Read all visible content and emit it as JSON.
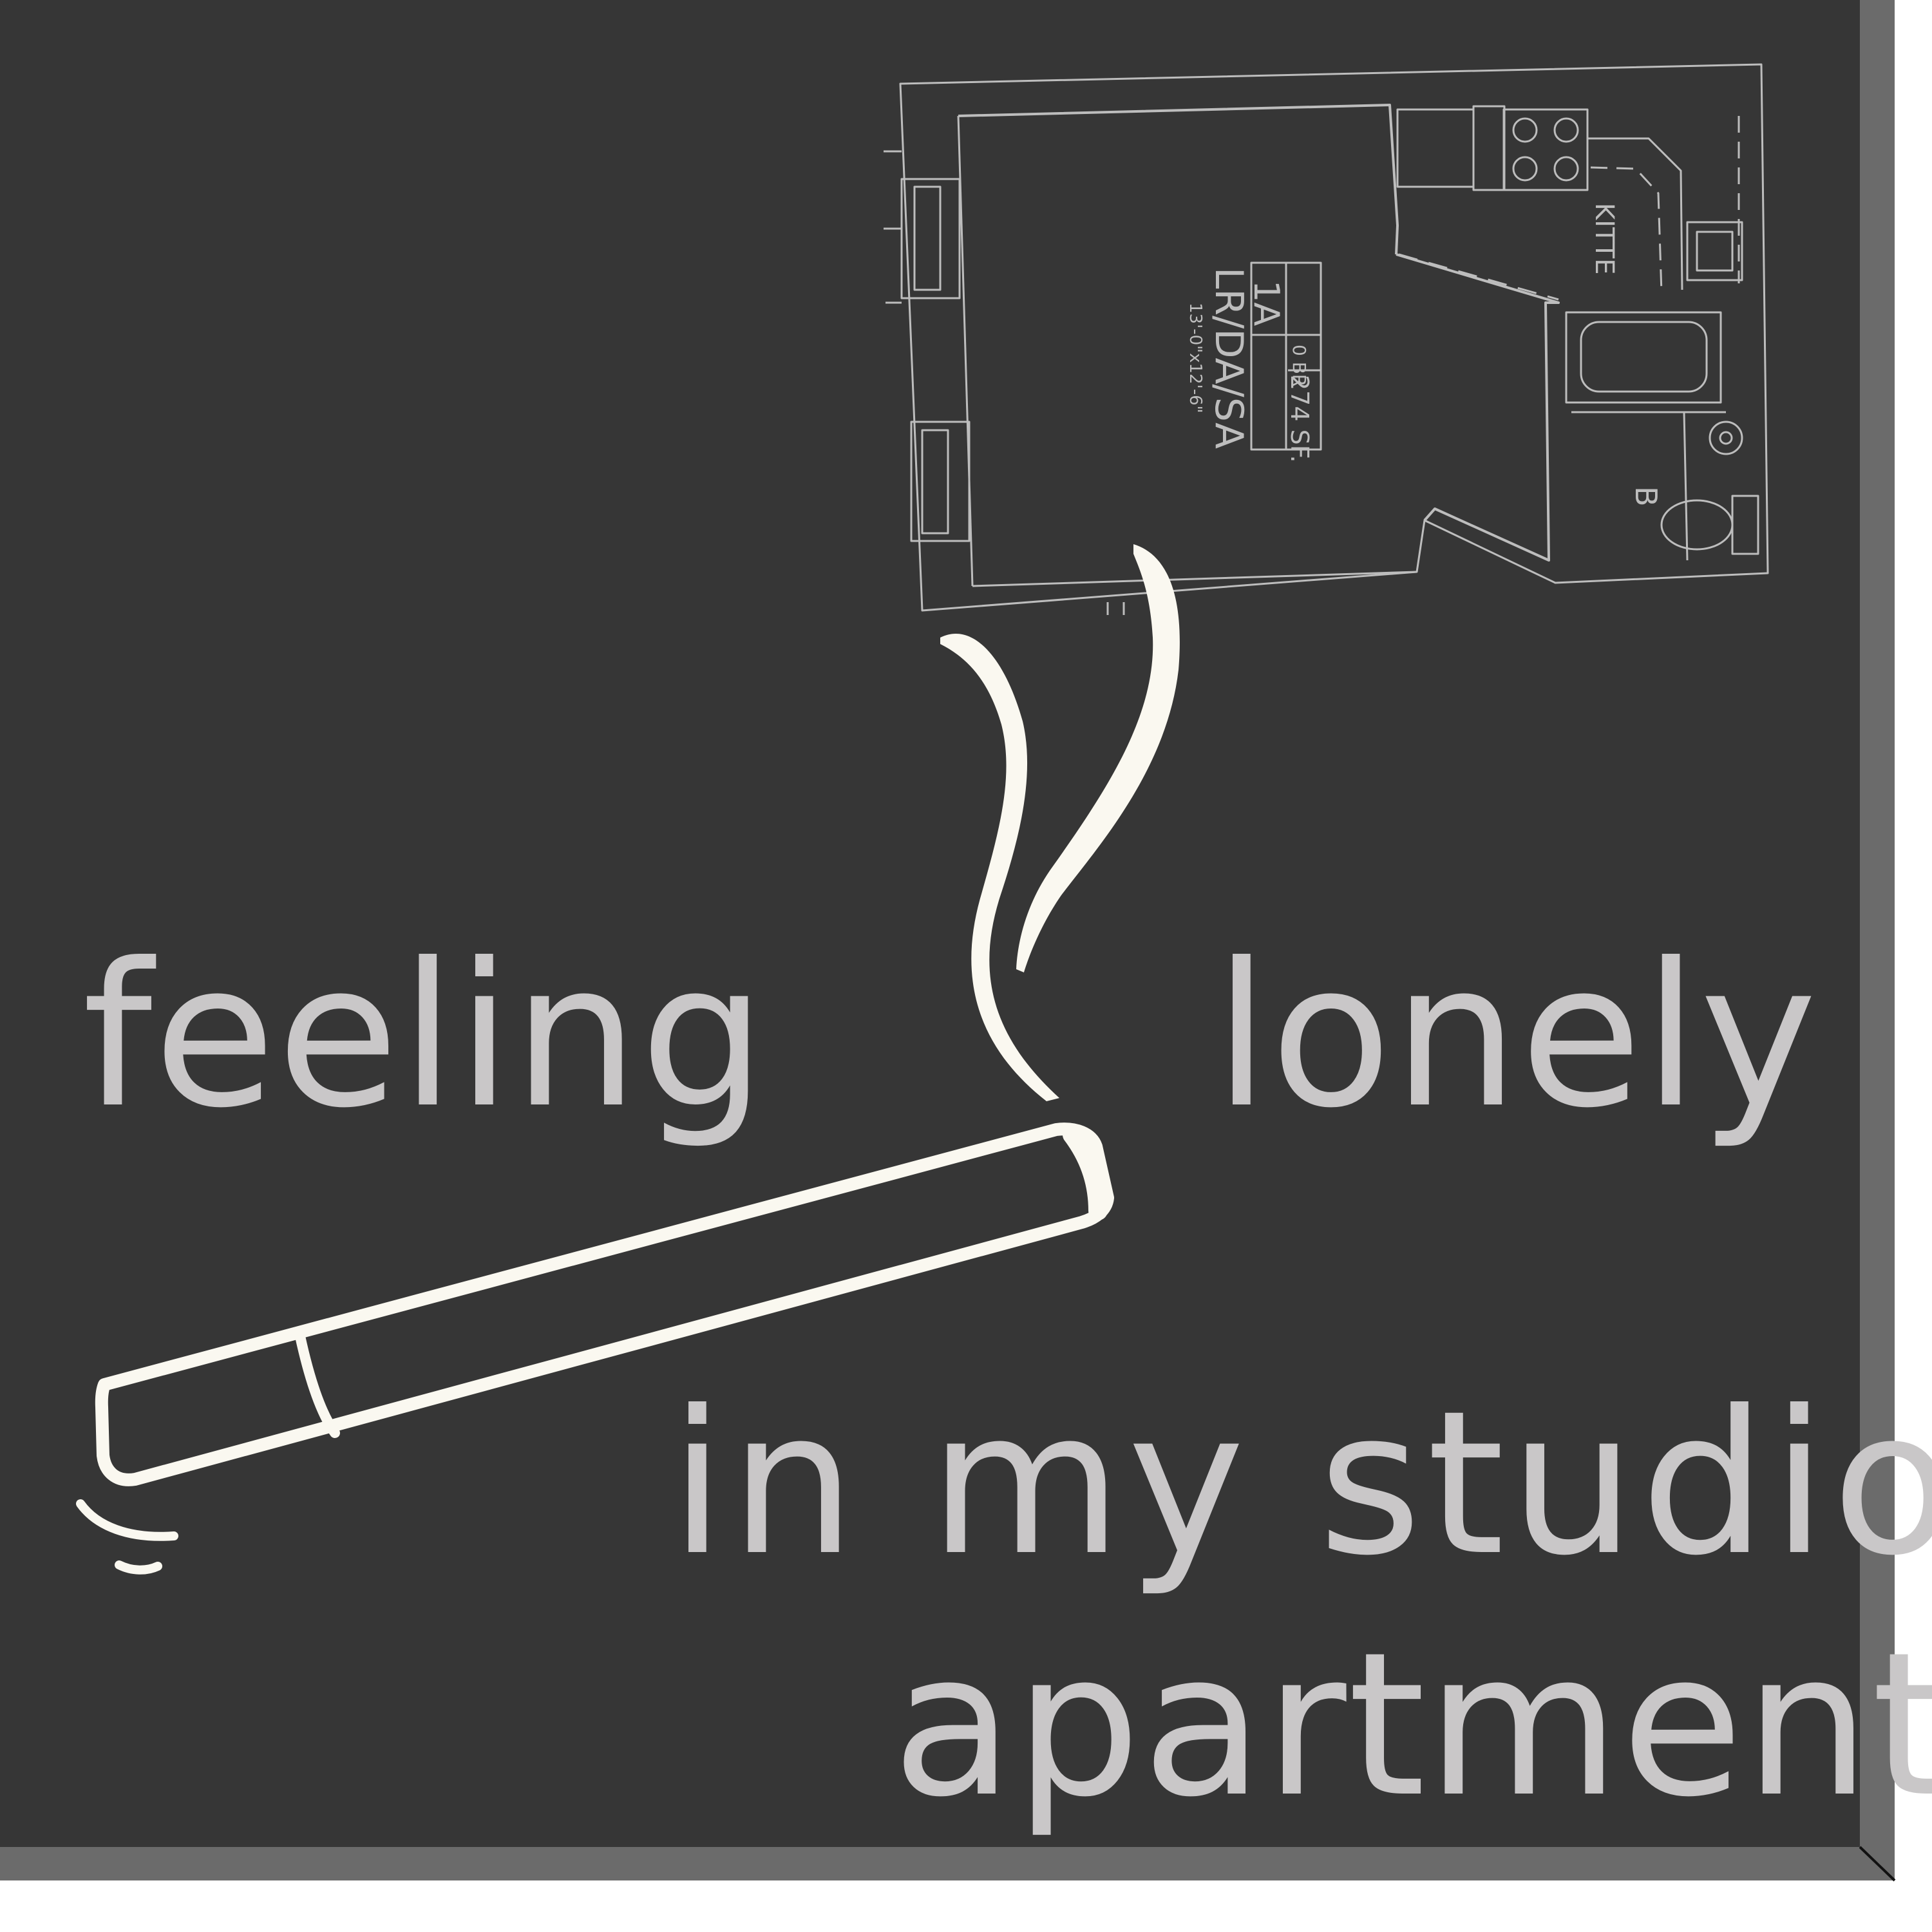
{
  "text": {
    "word_feeling": "feeling",
    "word_lonely": "lonely",
    "line_studio": "in my studio",
    "line_apartment": "apartment"
  },
  "floor_plan": {
    "unit_label": "1A",
    "bedroom_label": "0 BR",
    "area_label": "274 SF.",
    "room_label": "LR/DA/SA",
    "dimensions_label": "13'-0\"x12'-6\"",
    "kitchen_label": "KITTE",
    "bath_label": "B"
  },
  "colors": {
    "background": "#363636",
    "frame_edge": "#6b6b6b",
    "text": "#c9c7c8",
    "line_art": "#faf8f0",
    "plan_lines": "#bdbdbd"
  },
  "icons": [
    "cigarette-icon",
    "smoke-icon",
    "floor-plan-icon"
  ]
}
